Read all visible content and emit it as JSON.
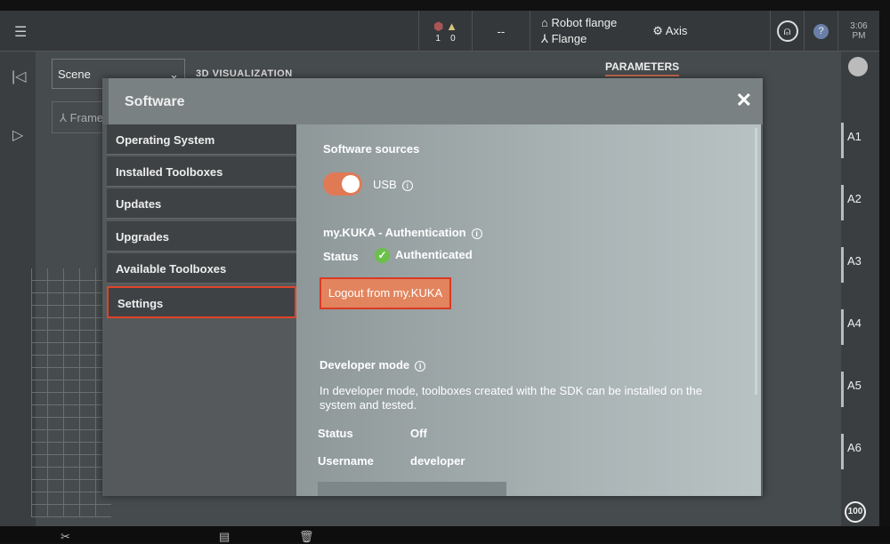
{
  "topbar": {
    "menu_icon": "hamburger-icon",
    "error_count": "1",
    "warning_count": "0",
    "status": "--",
    "tool": "Robot flange",
    "frame": "Flange",
    "jog_mode": "Axis",
    "time": "3:06",
    "ampm": "PM",
    "help": "?"
  },
  "background": {
    "scene_select": "Scene",
    "visualization_label": "3D VISUALIZATION",
    "frame_button": "Frame",
    "parameters_tab": "PARAMETERS",
    "axes": [
      "A1",
      "A2",
      "A3",
      "A4",
      "A5",
      "A6"
    ],
    "override": "100"
  },
  "dialog": {
    "title": "Software",
    "menu": [
      "Operating System",
      "Installed Toolboxes",
      "Updates",
      "Upgrades",
      "Available Toolboxes",
      "Settings"
    ],
    "selected": "Settings",
    "sources_heading": "Software sources",
    "usb_label": "USB",
    "usb_enabled": true,
    "auth_heading": "my.KUKA - Authentication",
    "status_label": "Status",
    "auth_status": "Authenticated",
    "logout_button": "Logout from my.KUKA",
    "dev_heading": "Developer mode",
    "dev_desc": "In developer mode, toolboxes created with the SDK can be installed on the system and tested.",
    "dev_status_label": "Status",
    "dev_status": "Off",
    "username_label": "Username",
    "username": "developer"
  },
  "colors": {
    "accent": "#e07a55",
    "highlight": "#e0442a",
    "ok": "#6ac04a"
  }
}
